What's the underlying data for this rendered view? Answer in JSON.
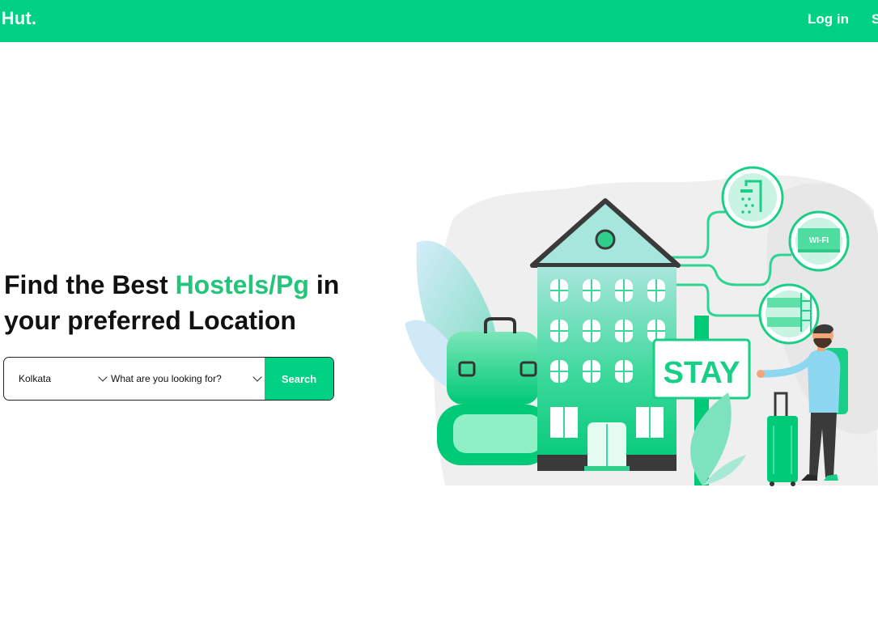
{
  "header": {
    "logo_text": "dHut.",
    "login_label": "Log in",
    "signup_label": "S"
  },
  "hero": {
    "title_part1": "Find the Best ",
    "title_accent": "Hostels/Pg",
    "title_part2": " in your preferred Location"
  },
  "search": {
    "city_value": "Kolkata",
    "type_placeholder": "What are you looking for?",
    "button_label": "Search"
  },
  "illustration": {
    "sign_text": "STAY",
    "wifi_text": "WI-FI"
  },
  "colors": {
    "brand": "#00d084",
    "accent_text": "#22c57a",
    "dark": "#3a3a3a"
  }
}
